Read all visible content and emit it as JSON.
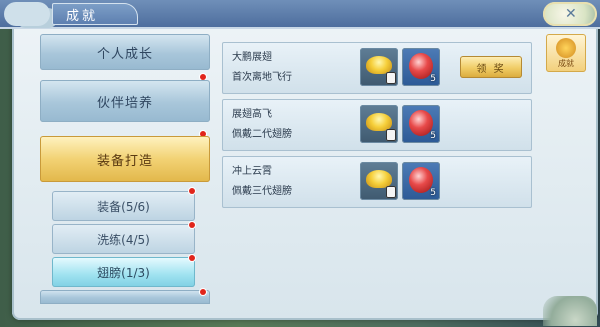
{
  "window": {
    "title": "成就"
  },
  "menu": {
    "items": [
      {
        "label": "个人成长"
      },
      {
        "label": "伙伴培养"
      },
      {
        "label": "装备打造"
      }
    ],
    "sub_items": [
      {
        "label": "装备(5/6)"
      },
      {
        "label": "洗练(4/5)"
      },
      {
        "label": "翅膀(1/3)"
      }
    ]
  },
  "achievements": [
    {
      "name": "大鹏展翅",
      "desc": "首次离地飞行",
      "reward_a_count": "",
      "reward_b_count": "5",
      "action_label": "领 奖"
    },
    {
      "name": "展翅高飞",
      "desc": "佩戴二代翅膀",
      "reward_a_count": "",
      "reward_b_count": "5"
    },
    {
      "name": "冲上云霄",
      "desc": "佩戴三代翅膀",
      "reward_a_count": "",
      "reward_b_count": "5"
    }
  ],
  "side_tab": {
    "label": "成就"
  },
  "colors": {
    "notification_dot": "#e1251b",
    "accent_gold": "#f0cc66"
  },
  "icons": {
    "reward_a": "gold-ingot-icon",
    "reward_b": "red-orb-icon",
    "close": "close-icon"
  }
}
